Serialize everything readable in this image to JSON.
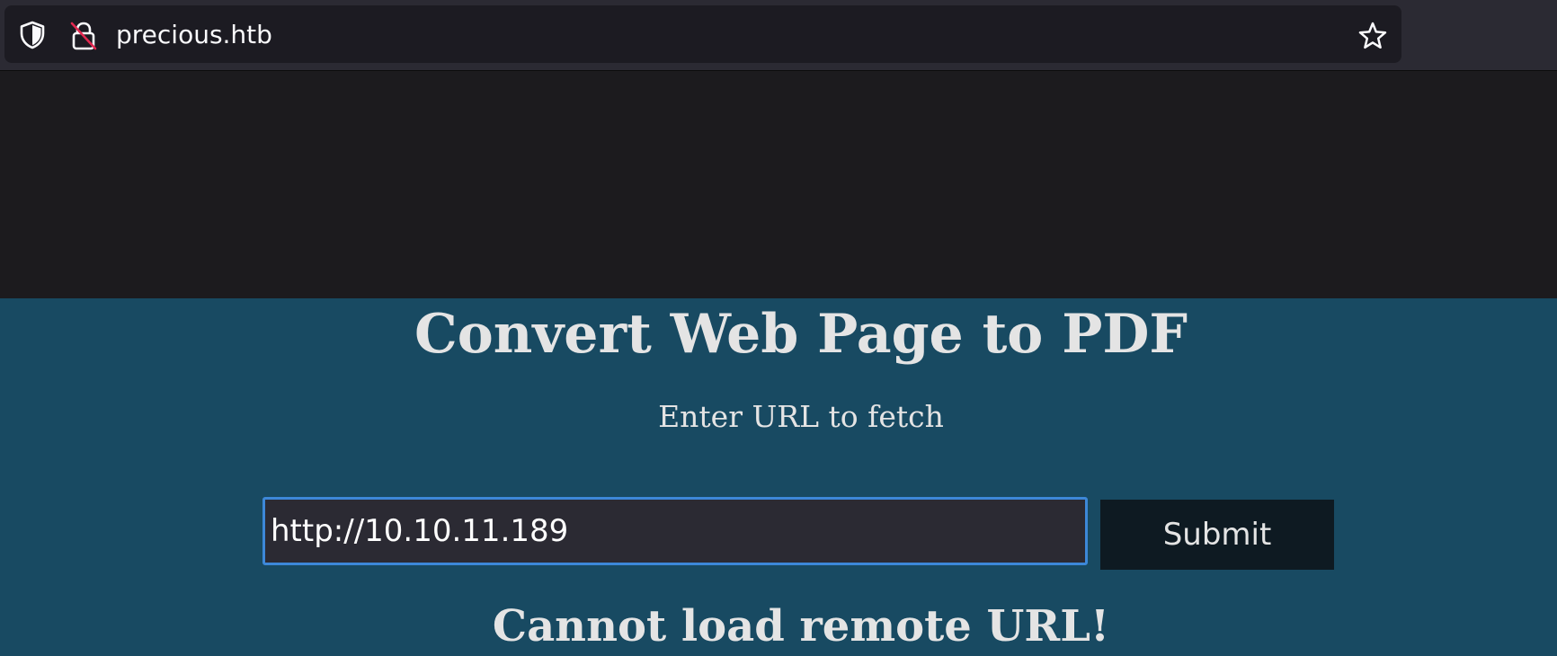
{
  "browser": {
    "url": "precious.htb",
    "icons": {
      "left": [
        "shield-icon",
        "lock-insecure-icon"
      ],
      "right": [
        "star-icon"
      ]
    }
  },
  "page": {
    "title": "Convert Web Page to PDF",
    "subtitle": "Enter URL to fetch",
    "url_input": {
      "value": "http://10.10.11.189",
      "placeholder": ""
    },
    "submit_label": "Submit",
    "error_message": "Cannot load remote URL!"
  },
  "colors": {
    "page_bg": "#184a62",
    "input_focus_border": "#3d88d8",
    "button_bg": "#0e1a22"
  }
}
